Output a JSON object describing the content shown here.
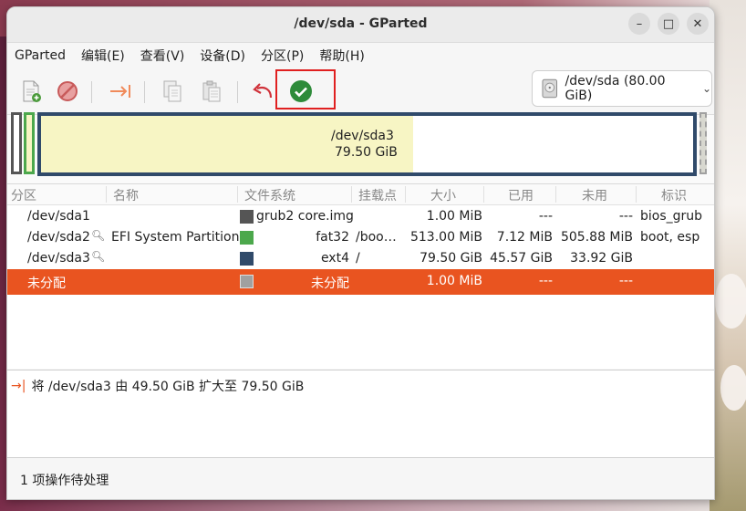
{
  "window": {
    "title": "/dev/sda - GParted"
  },
  "window_controls": {
    "minimize": "–",
    "maximize": "□",
    "close": "✕"
  },
  "menu": [
    "GParted",
    "编辑(E)",
    "查看(V)",
    "设备(D)",
    "分区(P)",
    "帮助(H)"
  ],
  "toolbar": {
    "buttons": [
      {
        "name": "new-partition",
        "icon": "new-document-icon"
      },
      {
        "name": "delete-partition",
        "icon": "delete-icon"
      },
      {
        "name": "resize-move",
        "icon": "resize-arrow-icon"
      },
      {
        "name": "copy",
        "icon": "copy-icon"
      },
      {
        "name": "paste",
        "icon": "paste-icon"
      },
      {
        "name": "undo",
        "icon": "undo-icon"
      },
      {
        "name": "apply",
        "icon": "apply-check-icon"
      }
    ]
  },
  "device_selector": {
    "label": "/dev/sda (80.00 GiB)",
    "icon": "disk-icon"
  },
  "disk_map": {
    "main_label": "/dev/sda3",
    "main_size": "79.50 GiB",
    "main_used_fraction": 0.57,
    "colors": {
      "ext4": "#304a6a",
      "fat32": "#4ca84c",
      "grub": "#555555",
      "unallocated": "#a0a0a0",
      "used_fill": "#f7f5c4"
    }
  },
  "table": {
    "columns": [
      "分区",
      "名称",
      "文件系统",
      "挂载点",
      "大小",
      "已用",
      "未用",
      "标识"
    ],
    "rows": [
      {
        "partition": "/dev/sda1",
        "name": "",
        "fs_color": "#555555",
        "fs": "grub2 core.img",
        "mount": "",
        "size": "1.00 MiB",
        "used": "---",
        "unused": "---",
        "flags": "bios_grub",
        "key": false
      },
      {
        "partition": "/dev/sda2",
        "name": "EFI System Partition",
        "fs_color": "#4ca84c",
        "fs": "fat32",
        "mount": "/boo…",
        "size": "513.00 MiB",
        "used": "7.12 MiB",
        "unused": "505.88 MiB",
        "flags": "boot, esp",
        "key": true
      },
      {
        "partition": "/dev/sda3",
        "name": "",
        "fs_color": "#304a6a",
        "fs": "ext4",
        "mount": "/",
        "size": "79.50 GiB",
        "used": "45.57 GiB",
        "unused": "33.92 GiB",
        "flags": "",
        "key": true
      },
      {
        "partition": "未分配",
        "name": "",
        "fs_color": "#a0a0a0",
        "fs": "未分配",
        "mount": "",
        "size": "1.00 MiB",
        "used": "---",
        "unused": "---",
        "flags": "",
        "key": false,
        "selected": true
      }
    ]
  },
  "operations": [
    {
      "icon": "resize-arrow-icon",
      "text": "将 /dev/sda3 由 49.50 GiB 扩大至 79.50 GiB"
    }
  ],
  "status": {
    "text": "1 项操作待处理"
  }
}
